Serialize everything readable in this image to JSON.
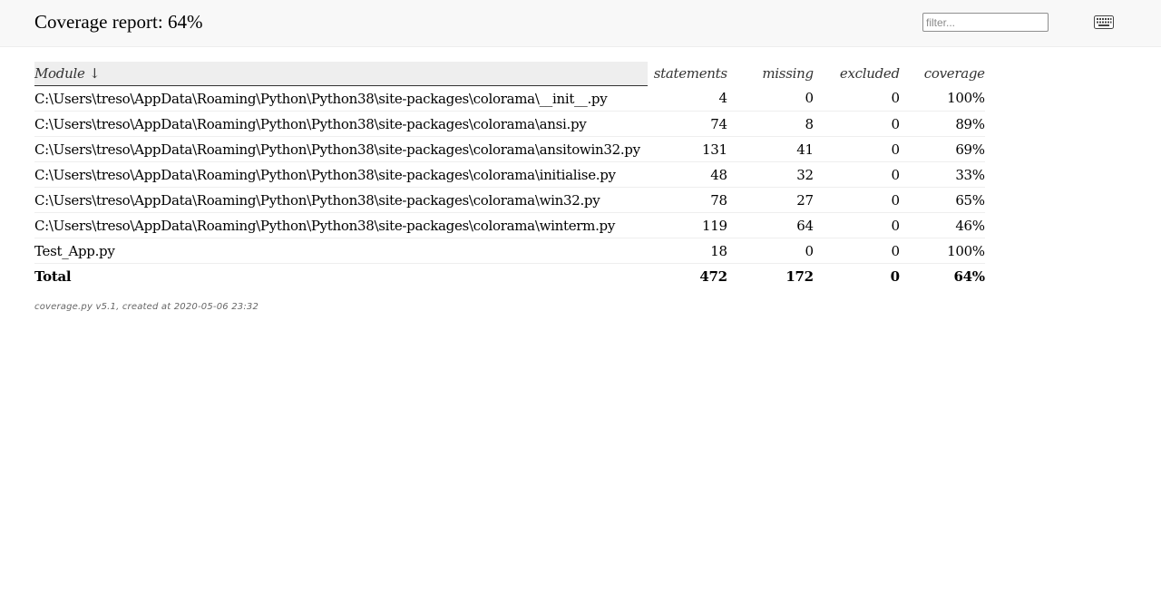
{
  "header": {
    "title": "Coverage report: 64%",
    "filter_placeholder": "filter...",
    "filter_value": "",
    "keyboard_icon": "keyboard-icon"
  },
  "table": {
    "columns": {
      "module": "Module ↓",
      "statements": "statements",
      "missing": "missing",
      "excluded": "excluded",
      "coverage": "coverage"
    },
    "rows": [
      {
        "module": "C:\\Users\\treso\\AppData\\Roaming\\Python\\Python38\\site-packages\\colorama\\__init__.py",
        "statements": "4",
        "missing": "0",
        "excluded": "0",
        "coverage": "100%"
      },
      {
        "module": "C:\\Users\\treso\\AppData\\Roaming\\Python\\Python38\\site-packages\\colorama\\ansi.py",
        "statements": "74",
        "missing": "8",
        "excluded": "0",
        "coverage": "89%"
      },
      {
        "module": "C:\\Users\\treso\\AppData\\Roaming\\Python\\Python38\\site-packages\\colorama\\ansitowin32.py",
        "statements": "131",
        "missing": "41",
        "excluded": "0",
        "coverage": "69%"
      },
      {
        "module": "C:\\Users\\treso\\AppData\\Roaming\\Python\\Python38\\site-packages\\colorama\\initialise.py",
        "statements": "48",
        "missing": "32",
        "excluded": "0",
        "coverage": "33%"
      },
      {
        "module": "C:\\Users\\treso\\AppData\\Roaming\\Python\\Python38\\site-packages\\colorama\\win32.py",
        "statements": "78",
        "missing": "27",
        "excluded": "0",
        "coverage": "65%"
      },
      {
        "module": "C:\\Users\\treso\\AppData\\Roaming\\Python\\Python38\\site-packages\\colorama\\winterm.py",
        "statements": "119",
        "missing": "64",
        "excluded": "0",
        "coverage": "46%"
      },
      {
        "module": "Test_App.py",
        "statements": "18",
        "missing": "0",
        "excluded": "0",
        "coverage": "100%"
      }
    ],
    "total": {
      "label": "Total",
      "statements": "472",
      "missing": "172",
      "excluded": "0",
      "coverage": "64%"
    }
  },
  "footer": {
    "text": "coverage.py v5.1, created at 2020-05-06 23:32"
  }
}
